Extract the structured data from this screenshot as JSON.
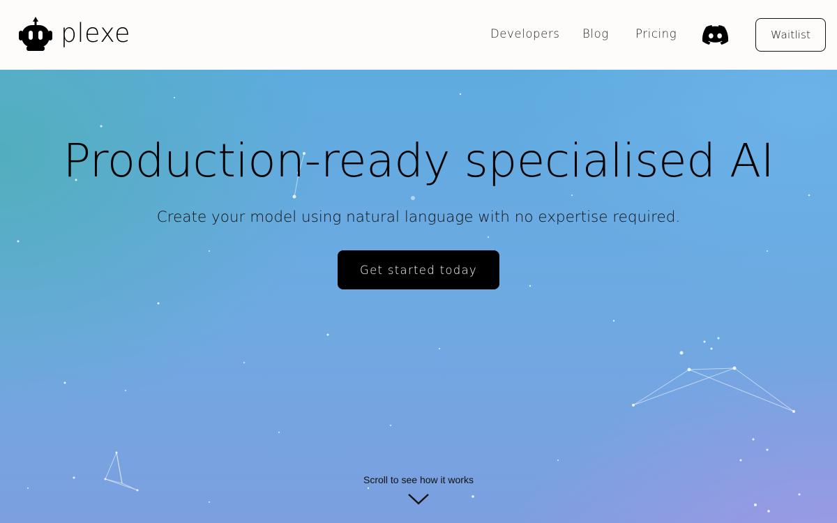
{
  "header": {
    "brand": "plexe",
    "logo_icon": "robot-head-icon",
    "nav": [
      {
        "label": "Developers"
      },
      {
        "label": "Blog"
      },
      {
        "label": "Pricing"
      }
    ],
    "discord_icon": "discord-icon",
    "waitlist_label": "Waitlist"
  },
  "hero": {
    "title": "Production-ready specialised AI",
    "subtitle": "Create your model using natural language with no expertise required.",
    "cta_label": "Get started today",
    "scroll_hint": "Scroll to see how it works",
    "scroll_icon": "chevron-down-icon"
  },
  "colors": {
    "header_bg": "#fdfcfa",
    "hero_teal": "#50afb9",
    "hero_blue": "#6fa9e2",
    "hero_lavender": "#aa96e6",
    "cta_bg": "#000000",
    "cta_text": "#ffffff"
  }
}
